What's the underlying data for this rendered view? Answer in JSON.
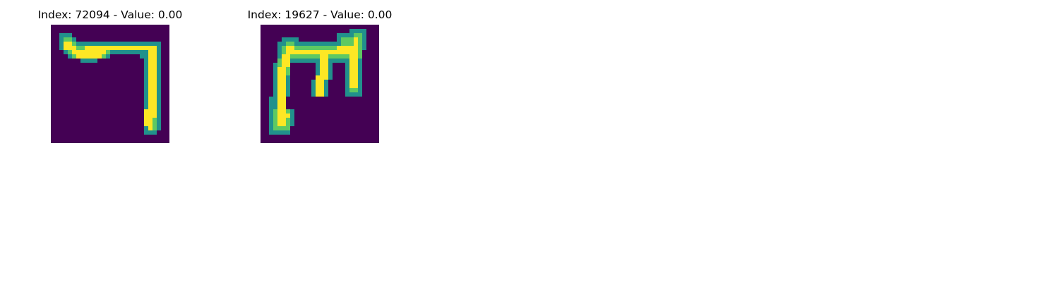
{
  "panels": [
    {
      "title": "Index: 72094 - Value: 0.00",
      "image_content": "handwritten glyph resembling a 7 / reversed L, yellow stroke on dark purple (viridis colormap)"
    },
    {
      "title": "Index: 19627 - Value: 0.00",
      "image_content": "handwritten glyph resembling an m with descender, yellow stroke on dark purple (viridis colormap)"
    }
  ],
  "colors": {
    "background": "#440154",
    "edge_dark": "#21918c",
    "edge_mid": "#5ec962",
    "stroke": "#fde725"
  }
}
